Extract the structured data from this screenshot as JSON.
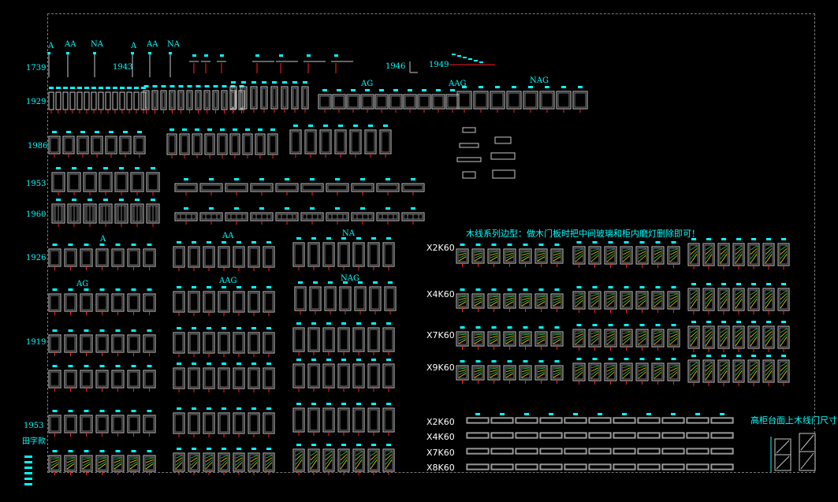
{
  "drawing": {
    "row_labels": [
      "1739",
      "1929",
      "1986",
      "1953",
      "1960",
      "1926",
      "1919",
      "1953",
      "田字款"
    ],
    "top_small_labels": [
      "A",
      "AA",
      "NA",
      "A",
      "AA",
      "NA"
    ],
    "year_1943": "1943",
    "year_1946": "1946",
    "year_1949": "1949",
    "group_1929": [
      "AG",
      "AAG",
      "NAG"
    ],
    "group_1926": [
      "A",
      "AA",
      "NA"
    ],
    "group_1926b": [
      "AG",
      "AAG",
      "NAG"
    ],
    "series_title": "木线系列边型：做木门板时把中间玻璃和柜内磨灯删除即可！",
    "series_codes": [
      "X2K60",
      "X4K60",
      "X7K60",
      "X9K60"
    ],
    "strip_codes": [
      "X2K60",
      "X4K60",
      "X7K60",
      "X8K60"
    ],
    "right_title": "高柜台面上木线门尺寸"
  },
  "colors": {
    "background": "#000000",
    "line": "#c8c8c8",
    "cyan": "#00ffff",
    "red": "#ff2020",
    "green": "#2ecc40",
    "yellow": "#ffd700",
    "frame": "#7a7a7a"
  }
}
